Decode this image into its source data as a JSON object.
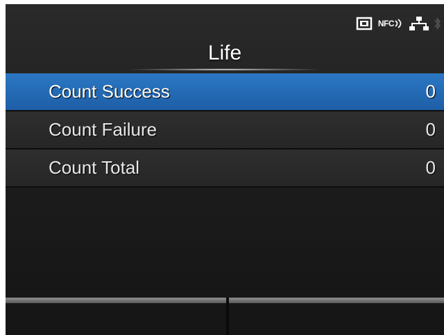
{
  "status_bar": {
    "icons": [
      "sd-card-icon",
      "nfc-icon",
      "network-icon",
      "bluetooth-icon"
    ],
    "nfc_label": "NFC"
  },
  "header": {
    "title": "Life"
  },
  "list": {
    "items": [
      {
        "label": "Count Success",
        "value": "0",
        "selected": true
      },
      {
        "label": "Count Failure",
        "value": "0",
        "selected": false
      },
      {
        "label": "Count Total",
        "value": "0",
        "selected": false
      }
    ]
  },
  "softkeys": {
    "left_label": "",
    "right_label": ""
  },
  "colors": {
    "selection": "#2c78c4",
    "background": "#1e1e1e",
    "text": "#ffffff"
  }
}
